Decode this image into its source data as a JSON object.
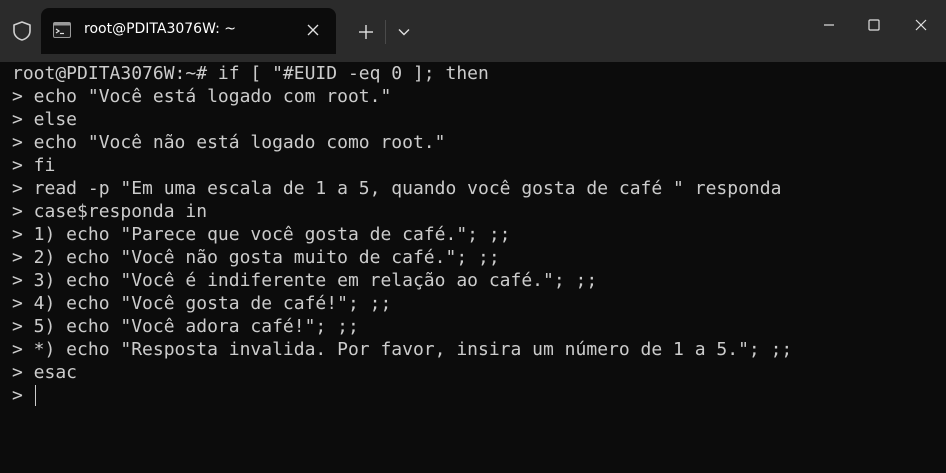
{
  "titlebar": {
    "tab_title": "root@PDITA3076W: ~",
    "icons": {
      "shield": "shield-icon",
      "terminal": "terminal-icon",
      "close_tab": "close-icon",
      "new_tab": "plus-icon",
      "dropdown": "chevron-down-icon",
      "minimize": "minimize-icon",
      "maximize": "maximize-icon",
      "close_window": "close-icon"
    }
  },
  "terminal": {
    "lines": [
      "root@PDITA3076W:~# if [ \"#EUID -eq 0 ]; then",
      "> echo \"Você está logado com root.\"",
      "> else",
      "> echo \"Você não está logado como root.\"",
      "> fi",
      "> read -p \"Em uma escala de 1 a 5, quando você gosta de café \" responda",
      "> case$responda in",
      "> 1) echo \"Parece que você gosta de café.\"; ;;",
      "> 2) echo \"Você não gosta muito de café.\"; ;;",
      "> 3) echo \"Você é indiferente em relação ao café.\"; ;;",
      "> 4) echo \"Você gosta de café!\"; ;;",
      "> 5) echo \"Você adora café!\"; ;;",
      "> *) echo \"Resposta invalida. Por favor, insira um número de 1 a 5.\"; ;;",
      "> esac"
    ],
    "current_prompt": ">"
  },
  "colors": {
    "titlebar_bg": "#2b2b2b",
    "terminal_bg": "#0c0c0c",
    "text": "#cccccc"
  }
}
